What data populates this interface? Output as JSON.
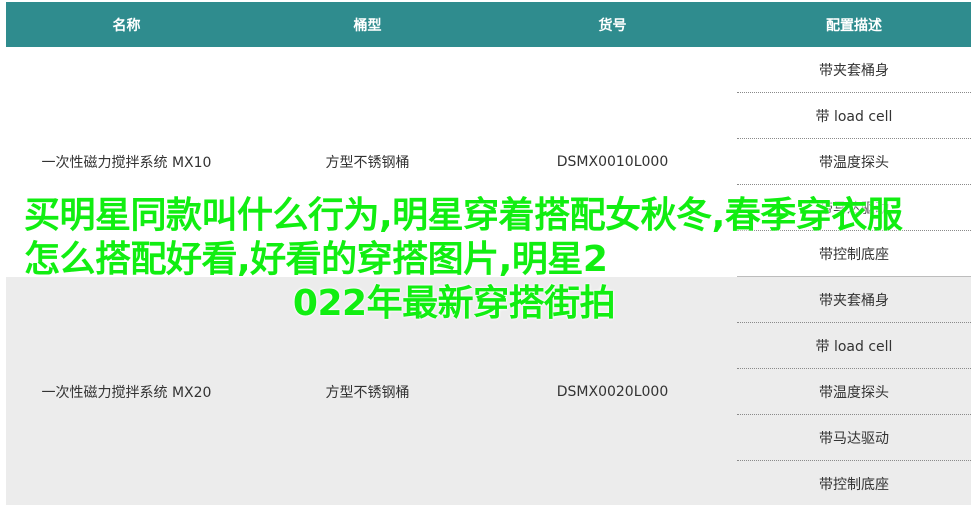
{
  "table": {
    "headers": [
      "名称",
      "桶型",
      "货号",
      "配置描述"
    ],
    "groups": [
      {
        "name": "一次性磁力搅拌系统 MX10",
        "type": "方型不锈钢桶",
        "sku": "DSMX0010L000",
        "configs": [
          "带夹套桶身",
          "带 load cell",
          "带温度探头",
          "带马达驱动",
          "带控制底座"
        ]
      },
      {
        "name": "一次性磁力搅拌系统 MX20",
        "type": "方型不锈钢桶",
        "sku": "DSMX0020L000",
        "configs": [
          "带夹套桶身",
          "带 load cell",
          "带温度探头",
          "带马达驱动",
          "带控制底座"
        ]
      }
    ]
  },
  "overlay": {
    "line1": "买明星同款叫什么行为,明星穿着搭配女秋冬,春",
    "line2": "季穿衣服怎么搭配好看,好看的穿搭图片,明星2",
    "line3": "022年最新穿搭街拍",
    "color": "#11ee11"
  },
  "colors": {
    "header_bg": "#2f8c8e",
    "header_text": "#ffffff",
    "alt_row_bg": "#ececec"
  }
}
